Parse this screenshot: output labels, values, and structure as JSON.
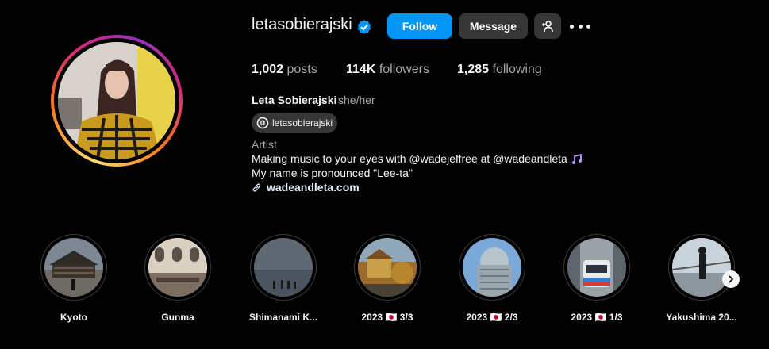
{
  "profile": {
    "username": "letasobierajski",
    "verified": true,
    "full_name": "Leta Sobierajski",
    "pronouns": "she/her",
    "threads_handle": "letasobierajski",
    "category": "Artist",
    "bio_line1": "Making music to your eyes with @wadejeffree at @wadeandleta",
    "bio_line2": "My name is pronounced \"Lee-ta\"",
    "link": "wadeandleta.com"
  },
  "actions": {
    "follow_label": "Follow",
    "message_label": "Message"
  },
  "stats": {
    "posts_value": "1,002",
    "posts_label": "posts",
    "followers_value": "114K",
    "followers_label": "followers",
    "following_value": "1,285",
    "following_label": "following"
  },
  "highlights": [
    {
      "label": "Kyoto"
    },
    {
      "label": "Gunma"
    },
    {
      "label": "Shimanami K..."
    },
    {
      "label": "2023 🇯🇵 3/3"
    },
    {
      "label": "2023 🇯🇵 2/3"
    },
    {
      "label": "2023 🇯🇵 1/3"
    },
    {
      "label": "Yakushima 20..."
    }
  ],
  "colors": {
    "background": "#000000",
    "follow_button": "#0095f6",
    "secondary_button": "#363636",
    "verified_badge": "#0095f6",
    "muted_text": "#a8a8a8"
  },
  "icons": [
    "verified-badge-icon",
    "add-user-icon",
    "more-options-icon",
    "threads-icon",
    "music-note-icon",
    "link-icon",
    "chevron-right-icon"
  ]
}
